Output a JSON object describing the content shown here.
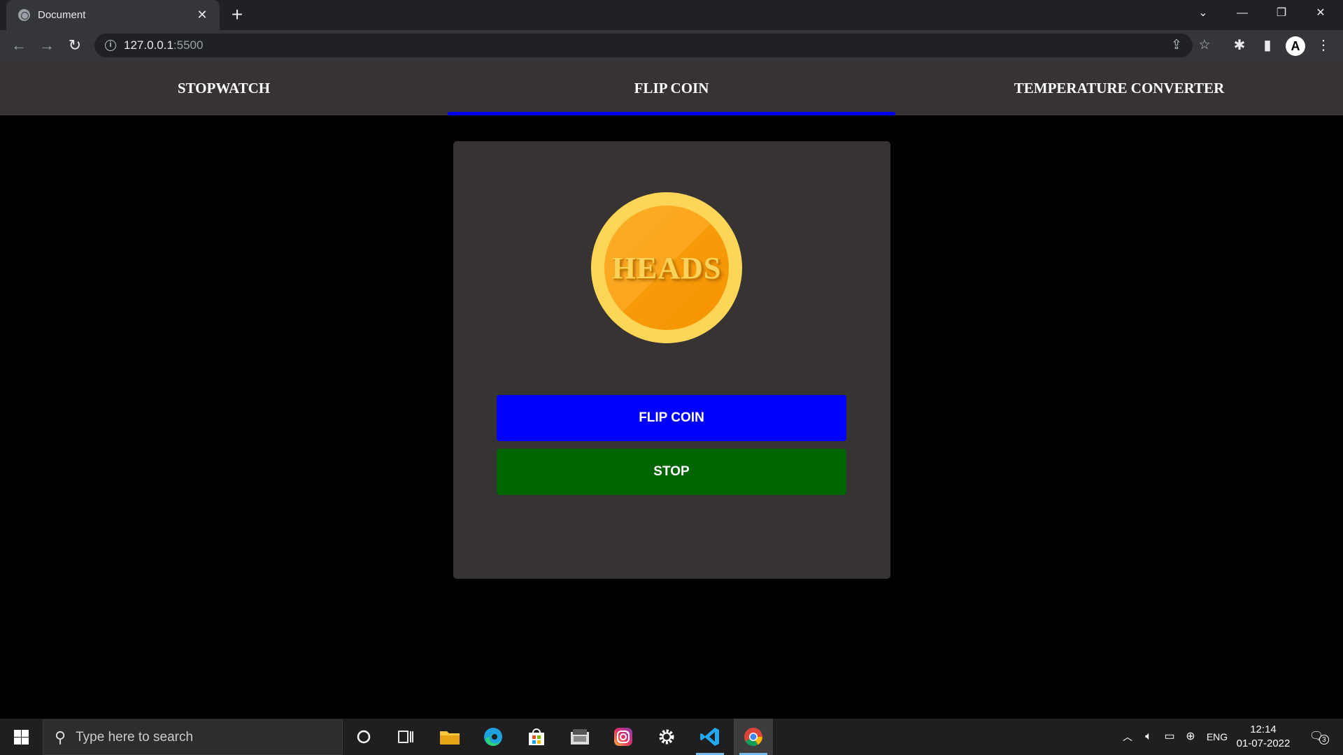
{
  "browser": {
    "tab_title": "Document",
    "tab_close": "✕",
    "new_tab": "+",
    "url_host": "127.0.0.1",
    "url_port": ":5500",
    "profile_initial": "A",
    "window_controls": [
      "⌄",
      "—",
      "❐",
      "✕"
    ]
  },
  "nav": {
    "items": [
      {
        "label": "STOPWATCH",
        "active": false
      },
      {
        "label": "FLIP COIN",
        "active": true
      },
      {
        "label": "TEMPERATURE CONVERTER",
        "active": false
      }
    ]
  },
  "coin": {
    "face_label": "HEADS",
    "outer_color": "#fdd658",
    "inner_color": "#fba61d"
  },
  "buttons": {
    "flip_label": "FLIP COIN",
    "flip_color": "#0000ff",
    "stop_label": "STOP",
    "stop_color": "#006400"
  },
  "taskbar": {
    "search_placeholder": "Type here to search",
    "apps": [
      "cortana-icon",
      "task-view-icon",
      "file-explorer-icon",
      "edge-icon",
      "store-icon",
      "mail-app-icon",
      "instagram-icon",
      "settings-icon",
      "vscode-icon",
      "chrome-icon"
    ],
    "language": "ENG",
    "time": "12:14",
    "date": "01-07-2022",
    "notifications": "3"
  },
  "colors": {
    "accent_underline": "#0000ee",
    "navbar_bg": "#373333",
    "page_bg": "#000000"
  }
}
